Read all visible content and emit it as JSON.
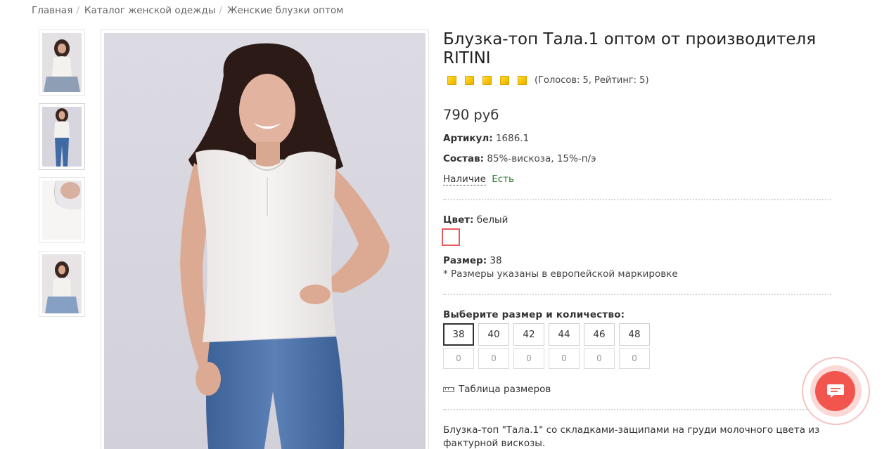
{
  "breadcrumb": [
    {
      "label": "Главная"
    },
    {
      "label": "Каталог женской одежды"
    },
    {
      "label": "Женские блузки оптом"
    }
  ],
  "breadcrumb_separator": "/",
  "product": {
    "title": "Блузка-топ Тала.1 оптом от производителя RITINI",
    "rating": {
      "stars": 5,
      "text": "(Голосов: 5, Рейтинг: 5)"
    },
    "price": "790 руб",
    "article_label": "Артикул:",
    "article_value": "1686.1",
    "composition_label": "Состав:",
    "composition_value": "85%-вискоза, 15%-п/э",
    "availability_label": "Наличие",
    "availability_value": "Есть",
    "color_label": "Цвет:",
    "color_value": "белый",
    "size_label": "Размер:",
    "size_value": "38",
    "size_note": "* Размеры указаны в европейской маркировке",
    "choose_label": "Выберите размер и количество:",
    "sizes": [
      {
        "size": "38",
        "qty": "0",
        "selected": true
      },
      {
        "size": "40",
        "qty": "0",
        "selected": false
      },
      {
        "size": "42",
        "qty": "0",
        "selected": false
      },
      {
        "size": "44",
        "qty": "0",
        "selected": false
      },
      {
        "size": "46",
        "qty": "0",
        "selected": false
      },
      {
        "size": "48",
        "qty": "0",
        "selected": false
      }
    ],
    "size_table_label": "Таблица размеров",
    "description": "Блузка-топ \"Тала.1\" со складками-защипами на груди молочного цвета из фактурной вискозы."
  },
  "colors": {
    "star": "#f7c300",
    "availability": "#2e7d32",
    "swatch_border": "#e85b5b",
    "chat": "#f2554d"
  },
  "icons": {
    "rating_star": "star-icon",
    "size_table": "ruler-icon",
    "chat": "chat-icon"
  }
}
